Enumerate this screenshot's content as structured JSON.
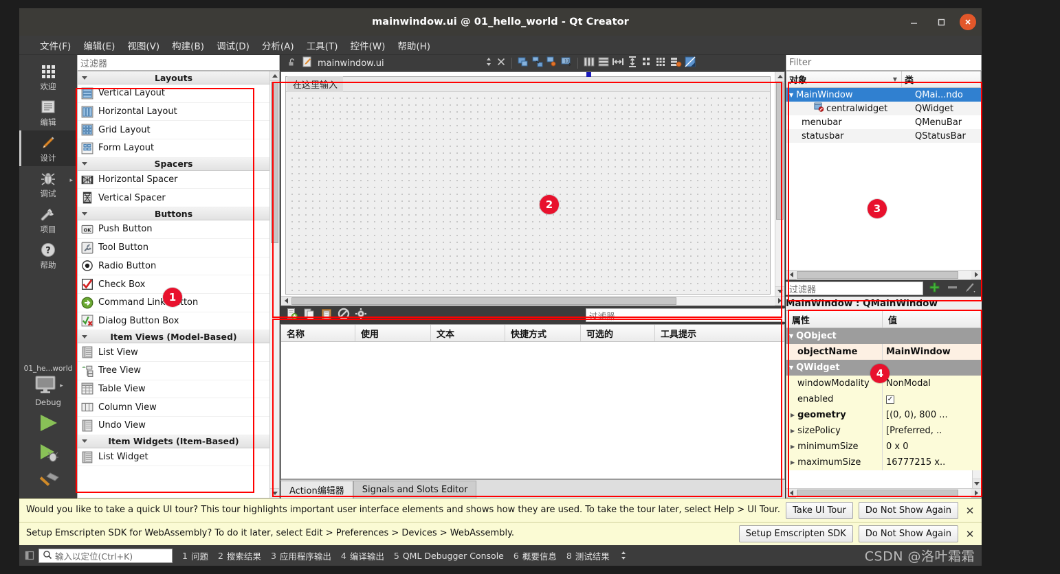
{
  "window": {
    "title": "mainwindow.ui @ 01_hello_world - Qt Creator",
    "minimize": "–",
    "maximize": "□",
    "close": "✕"
  },
  "menubar": [
    {
      "label": "文件(F)"
    },
    {
      "label": "编辑(E)"
    },
    {
      "label": "视图(V)"
    },
    {
      "label": "构建(B)"
    },
    {
      "label": "调试(D)"
    },
    {
      "label": "分析(A)"
    },
    {
      "label": "工具(T)"
    },
    {
      "label": "控件(W)"
    },
    {
      "label": "帮助(H)"
    }
  ],
  "modebar": {
    "items": [
      {
        "label": "欢迎",
        "icon": "grid-icon",
        "active": false,
        "arrow": false
      },
      {
        "label": "编辑",
        "icon": "document-icon",
        "active": false,
        "arrow": false
      },
      {
        "label": "设计",
        "icon": "pencil-icon",
        "active": true,
        "arrow": false
      },
      {
        "label": "调试",
        "icon": "bug-icon",
        "active": false,
        "arrow": true
      },
      {
        "label": "项目",
        "icon": "wrench-icon",
        "active": false,
        "arrow": false
      },
      {
        "label": "帮助",
        "icon": "question-icon",
        "active": false,
        "arrow": false
      }
    ],
    "kit_name": "01_he...world",
    "kit_config": "Debug",
    "run_icon": "play-icon",
    "debug_icon": "debug-play-icon",
    "build_icon": "hammer-icon"
  },
  "widget_box": {
    "header": "过滤器",
    "filter_placeholder": "过滤器",
    "groups": [
      {
        "title": "Layouts",
        "items": [
          {
            "label": "Vertical Layout",
            "icon": "vertical-layout-icon"
          },
          {
            "label": "Horizontal Layout",
            "icon": "horizontal-layout-icon"
          },
          {
            "label": "Grid Layout",
            "icon": "grid-layout-icon"
          },
          {
            "label": "Form Layout",
            "icon": "form-layout-icon"
          }
        ]
      },
      {
        "title": "Spacers",
        "items": [
          {
            "label": "Horizontal Spacer",
            "icon": "horizontal-spacer-icon"
          },
          {
            "label": "Vertical Spacer",
            "icon": "vertical-spacer-icon"
          }
        ]
      },
      {
        "title": "Buttons",
        "items": [
          {
            "label": "Push Button",
            "icon": "push-button-icon"
          },
          {
            "label": "Tool Button",
            "icon": "tool-button-icon"
          },
          {
            "label": "Radio Button",
            "icon": "radio-button-icon"
          },
          {
            "label": "Check Box",
            "icon": "check-box-icon"
          },
          {
            "label": "Command Link Button",
            "icon": "command-link-icon"
          },
          {
            "label": "Dialog Button Box",
            "icon": "dialog-button-box-icon"
          }
        ]
      },
      {
        "title": "Item Views (Model-Based)",
        "items": [
          {
            "label": "List View",
            "icon": "list-view-icon"
          },
          {
            "label": "Tree View",
            "icon": "tree-view-icon"
          },
          {
            "label": "Table View",
            "icon": "table-view-icon"
          },
          {
            "label": "Column View",
            "icon": "column-view-icon"
          },
          {
            "label": "Undo View",
            "icon": "undo-view-icon"
          }
        ]
      },
      {
        "title": "Item Widgets (Item-Based)",
        "items": [
          {
            "label": "List Widget",
            "icon": "list-widget-icon"
          }
        ]
      }
    ]
  },
  "editor": {
    "file_name": "mainwindow.ui",
    "lock_icon": "unlocked-icon",
    "file_icon": "ui-file-icon",
    "split_icon": "split-icon",
    "close_icon": "close-icon",
    "toolbar_icons": [
      "edit-widgets-icon",
      "edit-signals-slots-icon",
      "edit-buddies-icon",
      "edit-tab-order-icon",
      "layout-horizontal-icon",
      "layout-vertical-icon",
      "layout-splitter-h-icon",
      "layout-splitter-v-icon",
      "layout-form-icon",
      "layout-grid-icon",
      "break-layout-icon",
      "adjust-size-icon"
    ]
  },
  "form": {
    "menu_placeholder": "在这里输入"
  },
  "action_editor": {
    "toolbar_icons": [
      "new-action-icon",
      "copy-icon",
      "paste-icon",
      "delete-icon",
      "settings-icon"
    ],
    "filter_placeholder": "过滤器",
    "columns": [
      "名称",
      "使用",
      "文本",
      "快捷方式",
      "可选的",
      "工具提示"
    ],
    "rows": [],
    "tabs": [
      {
        "label": "Action编辑器",
        "active": true
      },
      {
        "label": "Signals and Slots Editor",
        "active": false
      }
    ]
  },
  "object_inspector": {
    "filter_placeholder": "Filter",
    "columns": [
      "对象",
      "类"
    ],
    "rows": [
      {
        "object": "MainWindow",
        "class": "QMai...ndo",
        "indent": 0,
        "selected": true,
        "expander": true,
        "icon": ""
      },
      {
        "object": "centralwidget",
        "class": "QWidget",
        "indent": 2,
        "selected": false,
        "expander": false,
        "icon": "central-widget-icon"
      },
      {
        "object": "menubar",
        "class": "QMenuBar",
        "indent": 1,
        "selected": false,
        "expander": false,
        "icon": ""
      },
      {
        "object": "statusbar",
        "class": "QStatusBar",
        "indent": 1,
        "selected": false,
        "expander": false,
        "icon": ""
      }
    ],
    "bottom_filter_placeholder": "过滤器",
    "bottom_tools": [
      "add-icon",
      "remove-icon",
      "configure-icon"
    ]
  },
  "property_editor": {
    "caption": "MainWindow : QMainWindow",
    "columns": [
      "属性",
      "值"
    ],
    "rows": [
      {
        "name": "QObject",
        "value": "",
        "kind": "group"
      },
      {
        "name": "objectName",
        "value": "MainWindow",
        "kind": "objname"
      },
      {
        "name": "QWidget",
        "value": "",
        "kind": "group"
      },
      {
        "name": "windowModality",
        "value": "NonModal",
        "kind": "plain"
      },
      {
        "name": "enabled",
        "value": "✓",
        "kind": "checkbox"
      },
      {
        "name": "geometry",
        "value": "[(0, 0), 800 ...",
        "kind": "expandable"
      },
      {
        "name": "sizePolicy",
        "value": "[Preferred, ..",
        "kind": "expandable"
      },
      {
        "name": "minimumSize",
        "value": "0 x 0",
        "kind": "expandable"
      },
      {
        "name": "maximumSize",
        "value": "16777215 x..",
        "kind": "expandable"
      }
    ]
  },
  "notifications": [
    {
      "text": "Would you like to take a quick UI tour? This tour highlights important user interface elements and shows how they are used. To take the tour later, select Help > UI Tour.",
      "primary": "Take UI Tour",
      "secondary": "Do Not Show Again",
      "close": "✕"
    },
    {
      "text": "Setup Emscripten SDK for WebAssembly? To do it later, select Edit > Preferences > Devices > WebAssembly.",
      "primary": "Setup Emscripten SDK",
      "secondary": "Do Not Show Again",
      "close": "✕"
    }
  ],
  "statusbar": {
    "toggle_icon": "sidebar-toggle-icon",
    "locator_icon": "search-icon",
    "locator_placeholder": "输入以定位(Ctrl+K)",
    "items": [
      {
        "num": "1",
        "label": "问题"
      },
      {
        "num": "2",
        "label": "搜索结果"
      },
      {
        "num": "3",
        "label": "应用程序输出"
      },
      {
        "num": "4",
        "label": "编译输出"
      },
      {
        "num": "5",
        "label": "QML Debugger Console"
      },
      {
        "num": "6",
        "label": "概要信息"
      },
      {
        "num": "8",
        "label": "测试结果"
      }
    ],
    "expand_icon": "updown-icon",
    "watermark": "CSDN @洛叶霜霜"
  },
  "callouts": [
    {
      "num": "1"
    },
    {
      "num": "2"
    },
    {
      "num": "3"
    },
    {
      "num": "4"
    }
  ],
  "colors": {
    "accent": "#e8112d",
    "selection": "#3080d0",
    "chrome": "#3c3c3c",
    "notification": "#fbfbd4"
  }
}
